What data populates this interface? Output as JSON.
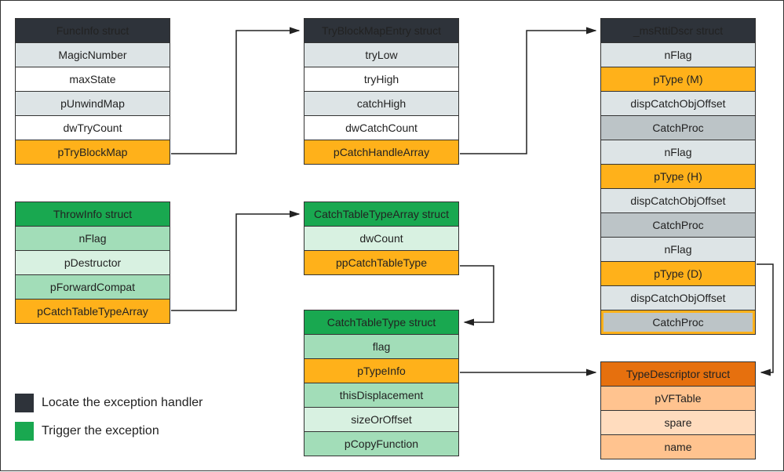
{
  "structs": {
    "funcinfo": {
      "title": "FuncInfo struct",
      "rows": [
        "MagicNumber",
        "maxState",
        "pUnwindMap",
        "dwTryCount",
        "pTryBlockMap"
      ]
    },
    "tryblock": {
      "title": "TryBlockMapEntry struct",
      "rows": [
        "tryLow",
        "tryHigh",
        "catchHigh",
        "dwCatchCount",
        "pCatchHandleArray"
      ]
    },
    "msrtti": {
      "title": "_msRttiDscr struct",
      "rows": [
        "nFlag",
        "pType (M)",
        "dispCatchObjOffset",
        "CatchProc",
        "nFlag",
        "pType (H)",
        "dispCatchObjOffset",
        "CatchProc",
        "nFlag",
        "pType (D)",
        "dispCatchObjOffset",
        "CatchProc"
      ]
    },
    "throwinfo": {
      "title": "ThrowInfo struct",
      "rows": [
        "nFlag",
        "pDestructor",
        "pForwardCompat",
        "pCatchTableTypeArray"
      ]
    },
    "catchtabletypearray": {
      "title": "CatchTableTypeArray struct",
      "rows": [
        "dwCount",
        "ppCatchTableType"
      ]
    },
    "catchtabletype": {
      "title": "CatchTableType struct",
      "rows": [
        "flag",
        "pTypeInfo",
        "thisDisplacement",
        "sizeOrOffset",
        "pCopyFunction"
      ]
    },
    "typedescriptor": {
      "title": "TypeDescriptor struct",
      "rows": [
        "pVFTable",
        "spare",
        "name"
      ]
    }
  },
  "legend": {
    "dark": "Locate the exception handler",
    "green": "Trigger the exception"
  }
}
